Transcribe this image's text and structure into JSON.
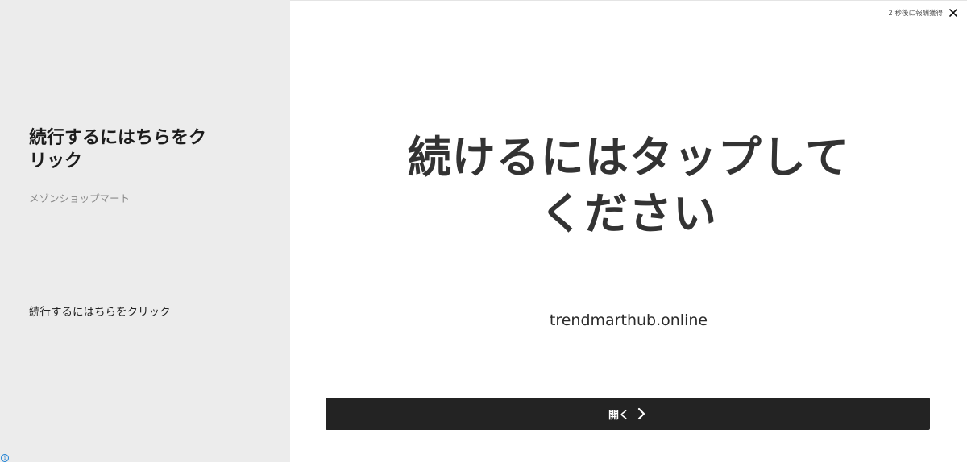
{
  "sidebar": {
    "headline": "続行するにはちらをクリック",
    "advertiser": "メゾンショップマート",
    "description": "続行するにはちらをクリック",
    "info_icon": "info-icon"
  },
  "main": {
    "countdown_label": "2 秒後に報酬獲得",
    "close_icon": "close-icon",
    "ad_headline_line1": "続けるにはタップして",
    "ad_headline_line2": "ください",
    "domain": "trendmarthub.online",
    "cta_label": "開く",
    "cta_icon": "chevron-right-icon"
  },
  "colors": {
    "sidebar_bg": "#ececec",
    "cta_bg": "#232323",
    "info_accent": "#1a7fd4"
  }
}
